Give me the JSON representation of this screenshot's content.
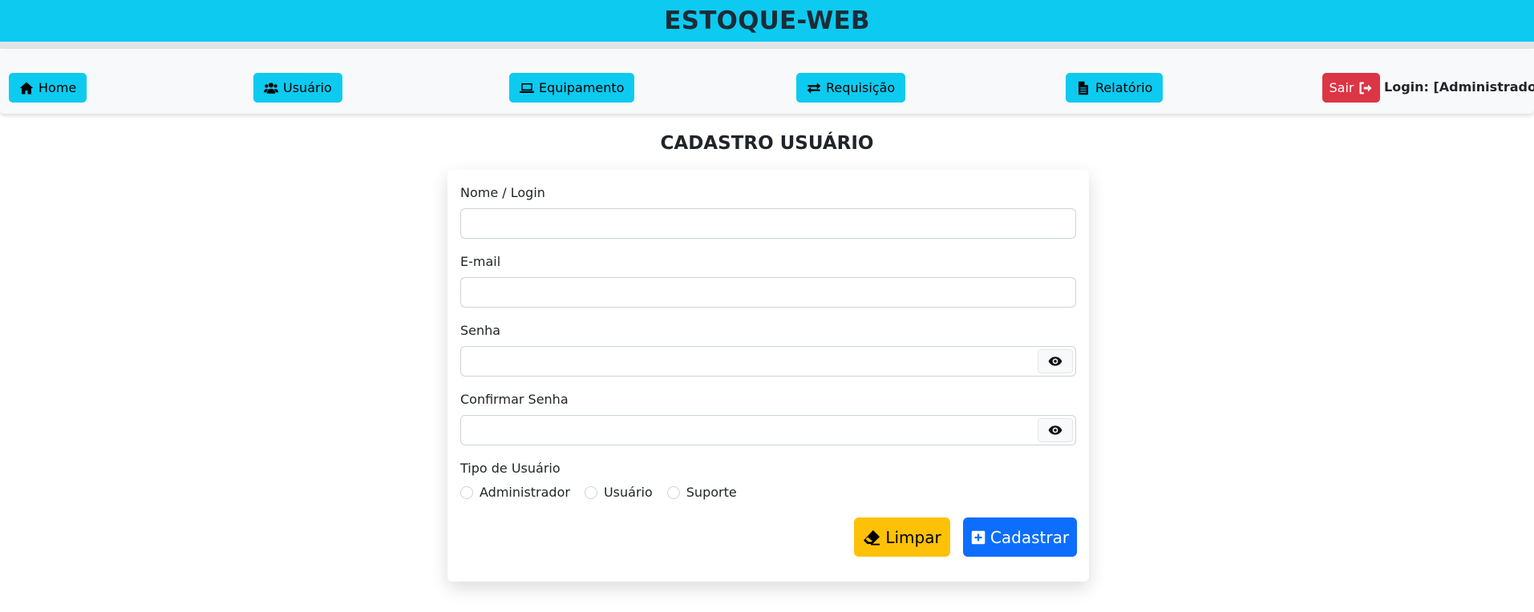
{
  "app": {
    "title": "ESTOQUE-WEB"
  },
  "nav": {
    "home": "Home",
    "usuario": "Usuário",
    "equipamento": "Equipamento",
    "requisicao": "Requisição",
    "relatorio": "Relatório",
    "sair": "Sair",
    "login_label": "Login: [Administrador]"
  },
  "page": {
    "title": "CADASTRO USUÁRIO"
  },
  "form": {
    "nome_label": "Nome / Login",
    "nome_value": "",
    "email_label": "E-mail",
    "email_value": "",
    "senha_label": "Senha",
    "senha_value": "",
    "confirmar_label": "Confirmar Senha",
    "confirmar_value": "",
    "tipo_label": "Tipo de Usuário",
    "tipo_options": [
      "Administrador",
      "Usuário",
      "Suporte"
    ],
    "limpar_label": "Limpar",
    "cadastrar_label": "Cadastrar"
  },
  "icons": {
    "home": "home-icon",
    "usuario": "users-icon",
    "equipamento": "laptop-icon",
    "requisicao": "exchange-icon",
    "relatorio": "file-icon",
    "sair": "sign-out-icon",
    "eye": "eye-icon",
    "eraser": "eraser-icon",
    "plus": "plus-square-icon"
  },
  "colors": {
    "header": "#0dcaf0",
    "nav_button": "#0dcaf0",
    "logout": "#dc3545",
    "clear": "#ffc107",
    "submit": "#0d6efd"
  }
}
